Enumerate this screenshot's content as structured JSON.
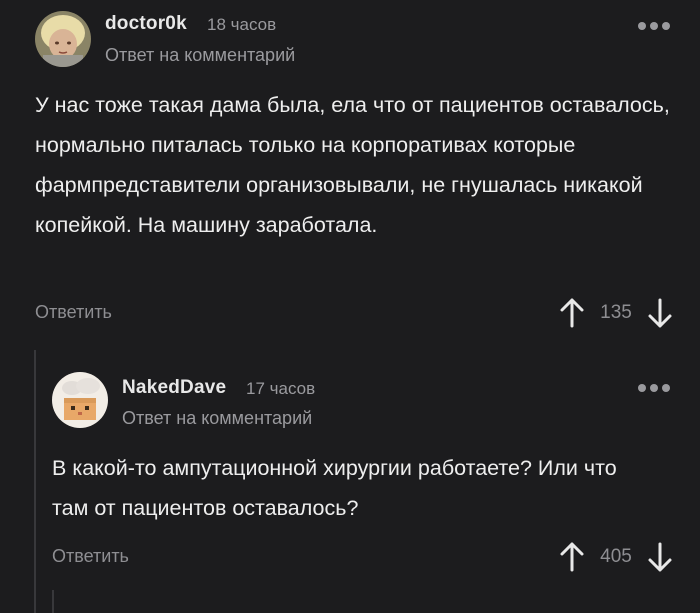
{
  "comments": [
    {
      "username": "doctor0k",
      "time": "18 часов",
      "reply_to": "Ответ на комментарий",
      "text": "У нас тоже такая дама была, ела что от пациентов оставалось, нормально питалась только на корпоративах которые фармпредставители организовывали, не гнушалась никакой копейкой. На машину заработала.",
      "reply_label": "Ответить",
      "rating": "135",
      "avatar_icon": "child-photo-avatar"
    },
    {
      "username": "NakedDave",
      "time": "17 часов",
      "reply_to": "Ответ на комментарий",
      "text": "В какой-то ампутационной хирургии работаете? Или что там от пациентов оставалось?",
      "reply_label": "Ответить",
      "rating": "405",
      "avatar_icon": "pixel-cat-avatar"
    }
  ],
  "colors": {
    "background": "#1c1c1e",
    "text": "#eeeeee",
    "muted": "#9a9a9e",
    "thread_line": "#38383b"
  }
}
